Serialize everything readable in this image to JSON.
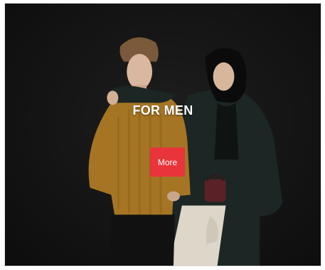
{
  "banner": {
    "title": "FOR MEN",
    "cta_label": "More",
    "colors": {
      "background": "#141414",
      "cta": "#e8343a",
      "title": "#ffffff"
    }
  }
}
